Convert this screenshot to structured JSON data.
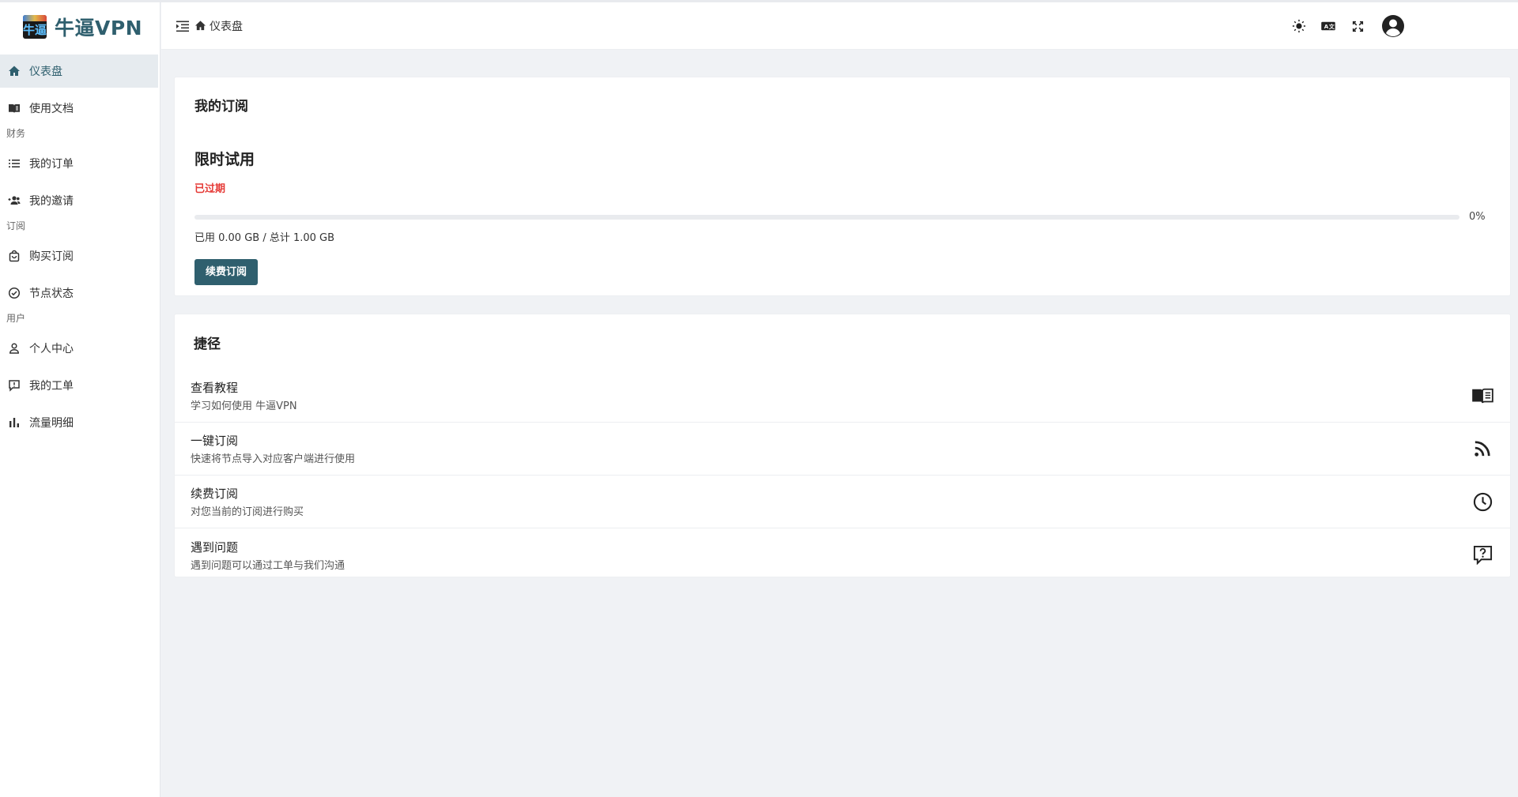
{
  "brand": {
    "name": "牛逼VPN",
    "logo_glyph": "牛逼"
  },
  "sidebar": {
    "items": [
      {
        "label": "仪表盘",
        "icon": "home-icon",
        "active": true
      },
      {
        "label": "使用文档",
        "icon": "book-icon"
      },
      {
        "section": "财务"
      },
      {
        "label": "我的订单",
        "icon": "list-icon"
      },
      {
        "label": "我的邀请",
        "icon": "user-plus-icon"
      },
      {
        "section": "订阅"
      },
      {
        "label": "购买订阅",
        "icon": "shopping-bag-icon"
      },
      {
        "label": "节点状态",
        "icon": "check-circle-icon"
      },
      {
        "section": "用户"
      },
      {
        "label": "个人中心",
        "icon": "user-icon"
      },
      {
        "label": "我的工单",
        "icon": "ticket-icon"
      },
      {
        "label": "流量明细",
        "icon": "bar-chart-icon"
      }
    ]
  },
  "header": {
    "breadcrumb": "仪表盘",
    "icons": [
      "theme-toggle-icon",
      "language-icon",
      "fullscreen-icon",
      "account-icon"
    ]
  },
  "subscription": {
    "title": "我的订阅",
    "plan_name": "限时试用",
    "status": "已过期",
    "progress_percent": 0,
    "progress_label": "0%",
    "usage_text": "已用 0.00 GB / 总计 1.00 GB",
    "renew_button": "续费订阅"
  },
  "shortcuts": {
    "title": "捷径",
    "items": [
      {
        "title": "查看教程",
        "desc": "学习如何使用 牛逼VPN",
        "icon": "book-open-icon"
      },
      {
        "title": "一键订阅",
        "desc": "快速将节点导入对应客户端进行使用",
        "icon": "rss-icon"
      },
      {
        "title": "续费订阅",
        "desc": "对您当前的订阅进行购买",
        "icon": "clock-icon"
      },
      {
        "title": "遇到问题",
        "desc": "遇到问题可以通过工单与我们沟通",
        "icon": "help-message-icon"
      }
    ]
  },
  "colors": {
    "accent": "#2f5f6e",
    "danger": "#e53935",
    "background": "#f0f2f5"
  }
}
